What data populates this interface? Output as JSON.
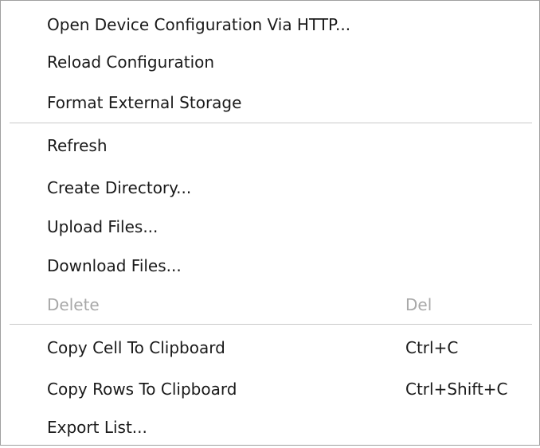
{
  "context_menu": {
    "groups": [
      {
        "items": [
          {
            "label": "Open Device Configuration Via HTTP...",
            "shortcut": "",
            "enabled": true
          },
          {
            "label": "Reload Configuration",
            "shortcut": "",
            "enabled": true
          },
          {
            "label": "Format External Storage",
            "shortcut": "",
            "enabled": true
          }
        ]
      },
      {
        "items": [
          {
            "label": "Refresh",
            "shortcut": "",
            "enabled": true
          },
          {
            "label": "Create Directory...",
            "shortcut": "",
            "enabled": true
          },
          {
            "label": "Upload Files...",
            "shortcut": "",
            "enabled": true
          },
          {
            "label": "Download Files...",
            "shortcut": "",
            "enabled": true
          },
          {
            "label": "Delete",
            "shortcut": "Del",
            "enabled": false
          }
        ]
      },
      {
        "items": [
          {
            "label": "Copy Cell To Clipboard",
            "shortcut": "Ctrl+C",
            "enabled": true
          },
          {
            "label": "Copy Rows To Clipboard",
            "shortcut": "Ctrl+Shift+C",
            "enabled": true
          },
          {
            "label": "Export List...",
            "shortcut": "",
            "enabled": true
          }
        ]
      }
    ]
  }
}
